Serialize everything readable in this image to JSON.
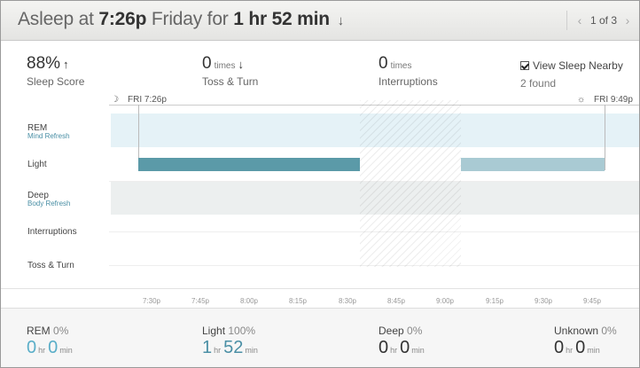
{
  "header": {
    "prefix": "Asleep at",
    "start_time": "7:26p",
    "day": "Friday for",
    "duration": "1 hr 52 min",
    "pager_label": "1 of 3"
  },
  "stats": {
    "sleep_score": {
      "value": "88%",
      "label": "Sleep Score",
      "trend": "up"
    },
    "toss_turn": {
      "value": "0",
      "unit": "times",
      "label": "Toss & Turn",
      "trend": "down"
    },
    "interruptions": {
      "value": "0",
      "unit": "times",
      "label": "Interruptions"
    },
    "nearby": {
      "label": "View Sleep Nearby",
      "checked": true,
      "found": "2 found"
    }
  },
  "timeline": {
    "start_caption": "FRI 7:26p",
    "end_caption": "FRI 9:49p",
    "rows": [
      {
        "label": "REM",
        "sub": "Mind Refresh"
      },
      {
        "label": "Light",
        "sub": ""
      },
      {
        "label": "Deep",
        "sub": "Body Refresh"
      },
      {
        "label": "Interruptions",
        "sub": ""
      },
      {
        "label": "Toss & Turn",
        "sub": ""
      }
    ],
    "axis_ticks": [
      "7:30p",
      "7:45p",
      "8:00p",
      "8:15p",
      "8:30p",
      "8:45p",
      "9:00p",
      "9:15p",
      "9:30p",
      "9:45p"
    ],
    "colors": {
      "light_main": "#5b9aa8",
      "light_faded": "#a9cad3",
      "rem_band": "#e5f2f7",
      "deep_band": "#ecefef"
    }
  },
  "footer": {
    "rem": {
      "label": "REM",
      "pct": "0%",
      "hr": "0",
      "min": "0"
    },
    "light": {
      "label": "Light",
      "pct": "100%",
      "hr": "1",
      "min": "52"
    },
    "deep": {
      "label": "Deep",
      "pct": "0%",
      "hr": "0",
      "min": "0"
    },
    "unknown": {
      "label": "Unknown",
      "pct": "0%",
      "hr": "0",
      "min": "0"
    },
    "units": {
      "hr": "hr",
      "min": "min"
    }
  }
}
